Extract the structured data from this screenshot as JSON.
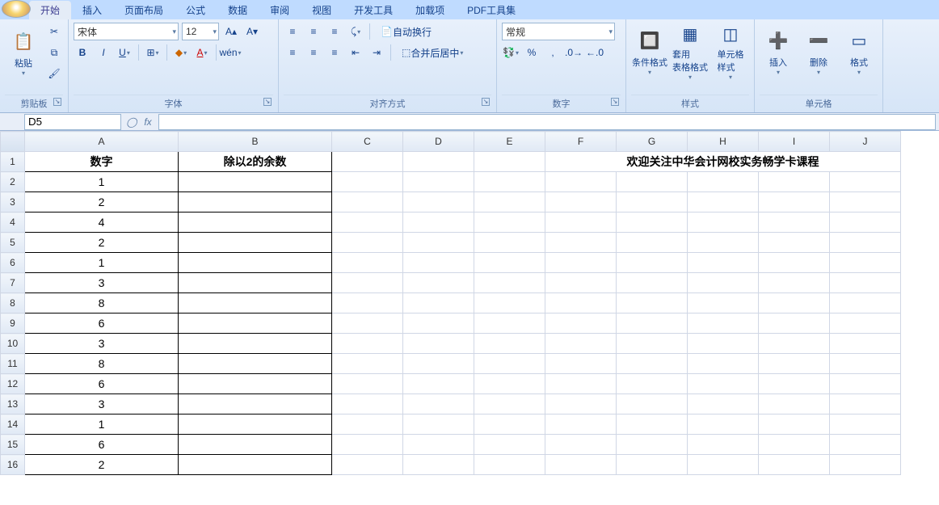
{
  "tabs": [
    "开始",
    "插入",
    "页面布局",
    "公式",
    "数据",
    "审阅",
    "视图",
    "开发工具",
    "加载项",
    "PDF工具集"
  ],
  "active_tab": 0,
  "groups": {
    "clipboard": {
      "label": "剪贴板",
      "paste": "粘贴"
    },
    "font": {
      "label": "字体",
      "name": "宋体",
      "size": "12"
    },
    "align": {
      "label": "对齐方式",
      "wrap": "自动换行",
      "merge": "合并后居中"
    },
    "number": {
      "label": "数字",
      "format": "常规"
    },
    "styles": {
      "label": "样式",
      "cond": "条件格式",
      "table": "套用\n表格格式",
      "cell": "单元格\n样式"
    },
    "cells": {
      "label": "单元格",
      "insert": "插入",
      "delete": "删除",
      "format": "格式"
    }
  },
  "namebox": "D5",
  "formula": "",
  "columns": [
    "A",
    "B",
    "C",
    "D",
    "E",
    "F",
    "G",
    "H",
    "I",
    "J"
  ],
  "headers": {
    "A": "数字",
    "B": "除以2的余数"
  },
  "banner": "欢迎关注中华会计网校实务畅学卡课程",
  "data_A": [
    "1",
    "2",
    "4",
    "2",
    "1",
    "3",
    "8",
    "6",
    "3",
    "8",
    "6",
    "3",
    "1",
    "6",
    "2"
  ],
  "row_count": 16
}
